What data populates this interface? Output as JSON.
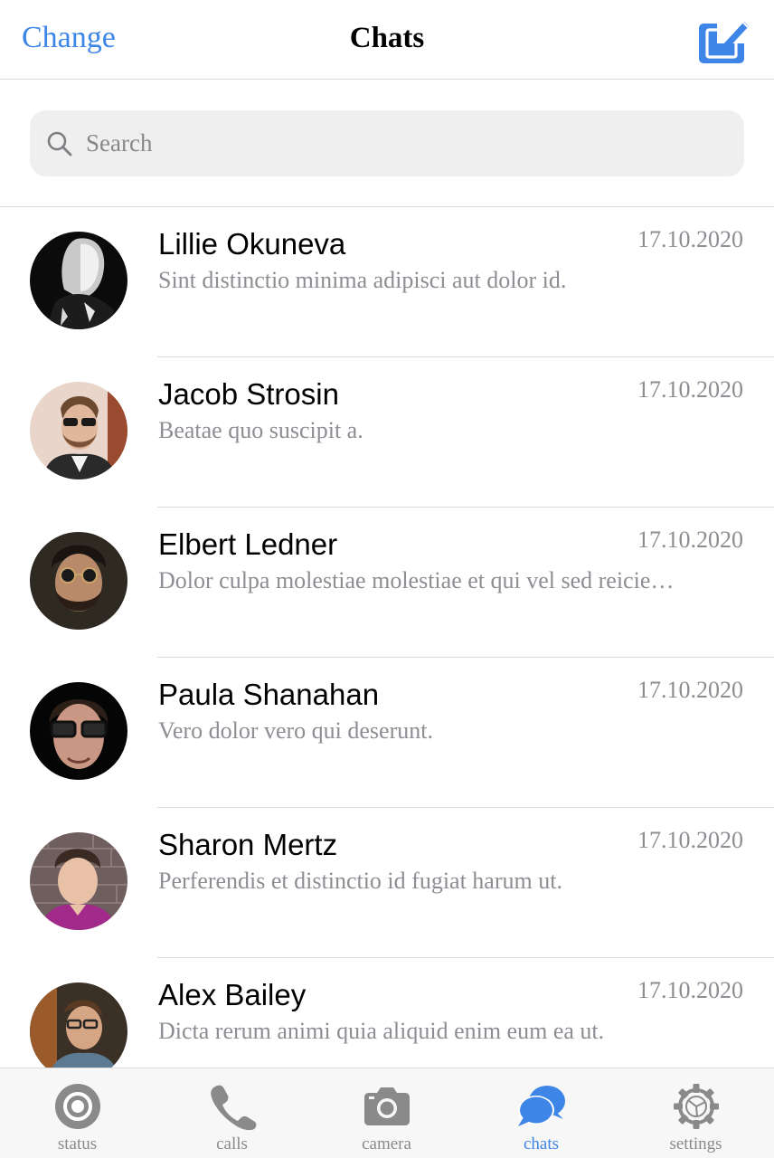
{
  "header": {
    "left_action": "Change",
    "title": "Chats",
    "compose_icon": "compose-icon"
  },
  "search": {
    "placeholder": "Search",
    "value": ""
  },
  "chats": [
    {
      "name": "Lillie Okuneva",
      "preview": "Sint distinctio minima adipisci aut dolor id.",
      "date": "17.10.2020"
    },
    {
      "name": "Jacob Strosin",
      "preview": "Beatae quo suscipit a.",
      "date": "17.10.2020"
    },
    {
      "name": "Elbert Ledner",
      "preview": "Dolor culpa molestiae molestiae et qui vel sed reicie…",
      "date": "17.10.2020"
    },
    {
      "name": "Paula Shanahan",
      "preview": "Vero dolor vero qui deserunt.",
      "date": "17.10.2020"
    },
    {
      "name": "Sharon Mertz",
      "preview": "Perferendis et distinctio id fugiat harum ut.",
      "date": "17.10.2020"
    },
    {
      "name": "Alex Bailey",
      "preview": "Dicta rerum animi quia aliquid enim eum ea ut.",
      "date": "17.10.2020"
    }
  ],
  "tabbar": {
    "tabs": [
      {
        "label": "status",
        "icon": "status-icon"
      },
      {
        "label": "calls",
        "icon": "phone-icon"
      },
      {
        "label": "camera",
        "icon": "camera-icon"
      },
      {
        "label": "chats",
        "icon": "chat-bubbles-icon"
      },
      {
        "label": "settings",
        "icon": "gear-icon"
      }
    ],
    "active": "chats"
  },
  "colors": {
    "accent": "#3d85e6",
    "secondary_text": "#8d8d93",
    "divider": "#dcdcdc",
    "search_bg": "#efefef"
  }
}
